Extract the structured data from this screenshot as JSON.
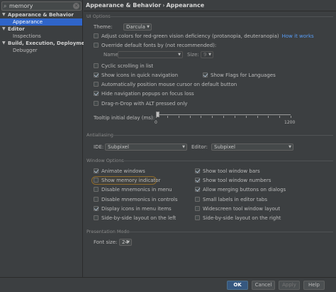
{
  "search": {
    "value": "memory"
  },
  "tree": [
    {
      "label": "Appearance & Behavior",
      "level": 0,
      "expanded": true
    },
    {
      "label": "Appearance",
      "level": 1,
      "selected": true
    },
    {
      "label": "Editor",
      "level": 0,
      "expanded": true
    },
    {
      "label": "Inspections",
      "level": 1
    },
    {
      "label": "Build, Execution, Deployment",
      "level": 0,
      "expanded": true
    },
    {
      "label": "Debugger",
      "level": 1
    }
  ],
  "breadcrumb": {
    "part1": "Appearance & Behavior",
    "separator": "›",
    "part2": "Appearance"
  },
  "ui_options": {
    "section_title": "UI Options",
    "theme_label": "Theme:",
    "theme_value": "Darcula",
    "adjust_colors": "Adjust colors for red-green vision deficiency (protanopia, deuteranopia)",
    "how_it_works": "How it works",
    "override_fonts": "Override default fonts by (not recommended):",
    "name_label": "Name:",
    "size_label": "Size:",
    "size_value": "9",
    "cyclic_scrolling": "Cyclic scrolling in list",
    "show_icons_quick_nav": "Show icons in quick navigation",
    "show_flags_languages": "Show Flags for Languages",
    "auto_position_mouse": "Automatically position mouse cursor on default button",
    "hide_nav_popups": "Hide navigation popups on focus loss",
    "drag_n_drop": "Drag-n-Drop with ALT pressed only",
    "tooltip_delay": "Tooltip initial delay (ms):",
    "slider_min": "0",
    "slider_max": "1200",
    "slider_value_fraction": 0.0
  },
  "antialiasing": {
    "section_title": "Antialiasing",
    "ide_label": "IDE:",
    "ide_value": "Subpixel",
    "editor_label": "Editor:",
    "editor_value": "Subpixel"
  },
  "window_options": {
    "section_title": "Window Options",
    "left": [
      {
        "label": "Animate windows",
        "checked": true
      },
      {
        "label": "Show memory indicator",
        "checked": false
      },
      {
        "label": "Disable mnemonics in menu",
        "checked": false
      },
      {
        "label": "Disable mnemonics in controls",
        "checked": false
      },
      {
        "label": "Display icons in menu items",
        "checked": true
      },
      {
        "label": "Side-by-side layout on the left",
        "checked": false
      }
    ],
    "right": [
      {
        "label": "Show tool window bars",
        "checked": true
      },
      {
        "label": "Show tool window numbers",
        "checked": true
      },
      {
        "label": "Allow merging buttons on dialogs",
        "checked": true
      },
      {
        "label": "Small labels in editor tabs",
        "checked": false
      },
      {
        "label": "Widescreen tool window layout",
        "checked": false
      },
      {
        "label": "Side-by-side layout on the right",
        "checked": false
      }
    ]
  },
  "presentation": {
    "section_title": "Presentation Mode",
    "font_size_label": "Font size:",
    "font_size_value": "24"
  },
  "buttons": {
    "ok": "OK",
    "cancel": "Cancel",
    "apply": "Apply",
    "help": "Help"
  }
}
